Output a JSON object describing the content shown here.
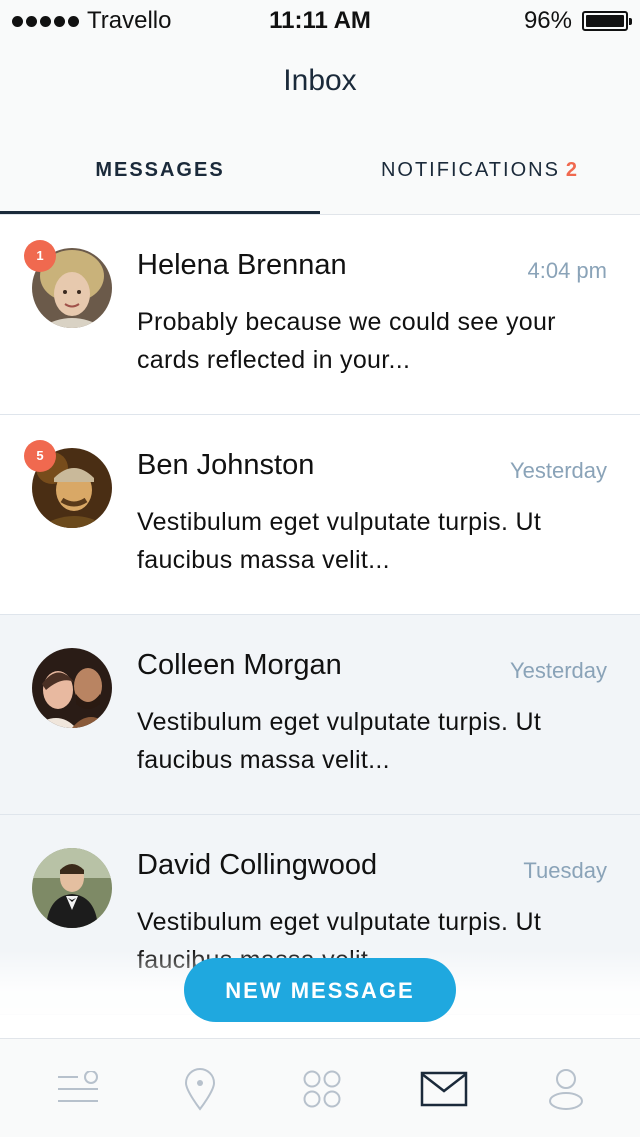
{
  "status_bar": {
    "carrier": "Travello",
    "time": "11:11 AM",
    "battery": "96%"
  },
  "header": {
    "title": "Inbox"
  },
  "tabs": [
    {
      "label": "MESSAGES",
      "active": true
    },
    {
      "label": "NOTIFICATIONS",
      "count": "2",
      "active": false
    }
  ],
  "messages": [
    {
      "name": "Helena Brennan",
      "time": "4:04 pm",
      "snippet": "Probably because we could see your cards reflected in your...",
      "unread": "1",
      "avatar": "helena-avatar"
    },
    {
      "name": "Ben Johnston",
      "time": "Yesterday",
      "snippet": "Vestibulum eget vulputate turpis. Ut faucibus massa velit...",
      "unread": "5",
      "avatar": "ben-avatar"
    },
    {
      "name": "Colleen Morgan",
      "time": "Yesterday",
      "snippet": "Vestibulum eget vulputate turpis. Ut faucibus massa velit...",
      "unread": "",
      "avatar": "colleen-avatar"
    },
    {
      "name": "David Collingwood",
      "time": "Tuesday",
      "snippet": "Vestibulum eget vulputate turpis. Ut faucibus massa velit...",
      "unread": "",
      "avatar": "david-avatar"
    }
  ],
  "fab": {
    "label": "NEW MESSAGE"
  },
  "tabbar": {
    "items": [
      {
        "icon": "feed-icon"
      },
      {
        "icon": "location-pin-icon"
      },
      {
        "icon": "apps-grid-icon"
      },
      {
        "icon": "mail-icon",
        "active": true
      },
      {
        "icon": "profile-icon"
      }
    ]
  },
  "colors": {
    "accent": "#1fa8df",
    "badge": "#f0694f",
    "navy": "#1b2a3a",
    "muted": "#8aa3b8",
    "unread_row": "#ffffff",
    "read_row": "#f2f5f8"
  }
}
